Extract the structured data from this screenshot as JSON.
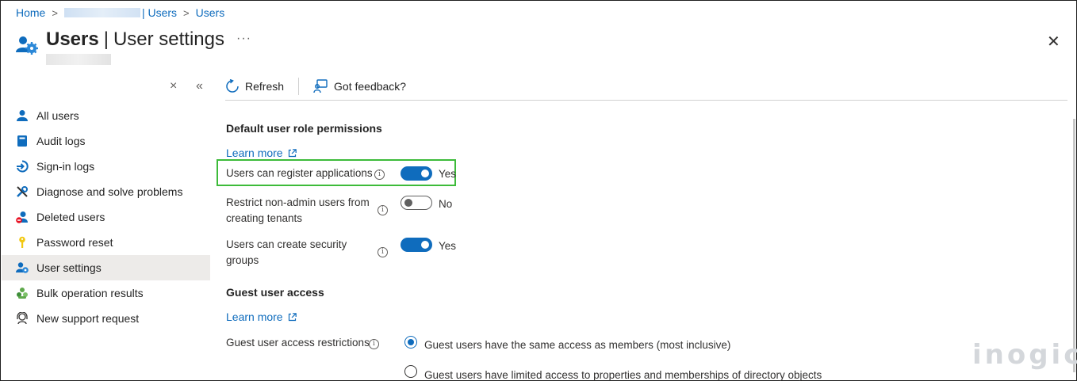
{
  "breadcrumb": {
    "home": "Home",
    "sep": ">",
    "pipe_users": "| Users",
    "users": "Users"
  },
  "header": {
    "title_bold": "Users",
    "title_pipe": "|",
    "title_rest": "User settings",
    "more": "···",
    "close": "✕"
  },
  "nav_controls": {
    "collapse_x": "×",
    "collapse_chev": "«"
  },
  "nav": {
    "items": [
      {
        "label": "All users",
        "icon": "user-icon",
        "color": "#0f6cbd"
      },
      {
        "label": "Audit logs",
        "icon": "book-icon",
        "color": "#0f6cbd"
      },
      {
        "label": "Sign-in logs",
        "icon": "signin-icon",
        "color": "#0f6cbd"
      },
      {
        "label": "Diagnose and solve problems",
        "icon": "wrench-icon",
        "color": "#0f6cbd"
      },
      {
        "label": "Deleted users",
        "icon": "deleted-user-icon",
        "color": "#0f6cbd"
      },
      {
        "label": "Password reset",
        "icon": "key-icon",
        "color": "#f2c811"
      },
      {
        "label": "User settings",
        "icon": "user-gear-icon",
        "color": "#0f6cbd",
        "active": true
      },
      {
        "label": "Bulk operation results",
        "icon": "people-icon",
        "color": "#5ea84b"
      },
      {
        "label": "New support request",
        "icon": "support-icon",
        "color": "#323130"
      }
    ]
  },
  "toolbar": {
    "refresh": "Refresh",
    "feedback": "Got feedback?"
  },
  "content": {
    "section1": "Default user role permissions",
    "learn_more_1": "Learn more",
    "settings": [
      {
        "label": "Users can register applications",
        "value": "Yes",
        "on": true
      },
      {
        "label_line1": "Restrict non-admin users from",
        "label_line2": "creating tenants",
        "value": "No",
        "on": false
      },
      {
        "label_line1": "Users can create security",
        "label_line2": "groups",
        "value": "Yes",
        "on": true
      }
    ],
    "section2": "Guest user access",
    "learn_more_2": "Learn more",
    "guest_restrictions_label": "Guest user access restrictions",
    "guest_options": [
      {
        "label": "Guest users have the same access as members (most inclusive)",
        "selected": true
      },
      {
        "label": "Guest users have limited access to properties and memberships of directory objects",
        "selected": false
      }
    ]
  },
  "watermark": "inogic",
  "colors": {
    "accent": "#0f6cbd",
    "highlight": "#3dbb3a"
  }
}
